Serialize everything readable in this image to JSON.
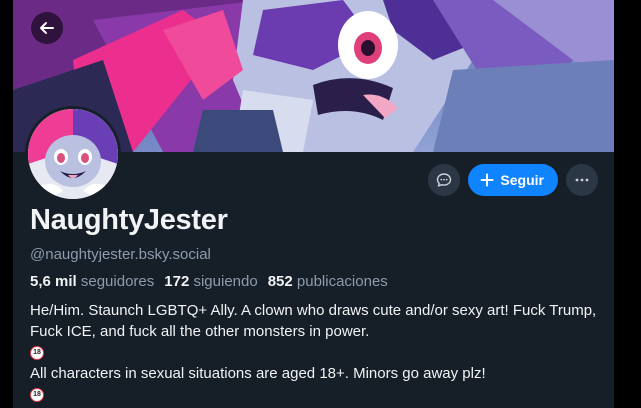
{
  "profile": {
    "display_name": "NaughtyJester",
    "handle": "@naughtyjester.bsky.social",
    "stats": {
      "followers_count": "5,6 mil",
      "followers_label": "seguidores",
      "following_count": "172",
      "following_label": "siguiendo",
      "posts_count": "852",
      "posts_label": "publicaciones"
    },
    "bio": {
      "line1": "He/Him. Staunch LGBTQ+ Ally. A clown who draws cute and/or sexy art! Fuck Trump, Fuck ICE, and fuck all the other monsters in power.",
      "badge1": "18",
      "line2": "All characters in sexual situations are aged 18+. Minors go away plz!",
      "badge2": "18"
    }
  },
  "actions": {
    "follow_label": "Seguir",
    "follow_icon": "plus-icon",
    "message_icon": "chat-bubble-icon",
    "more_icon": "ellipsis-icon"
  },
  "header": {
    "back_icon": "arrow-left-icon"
  },
  "colors": {
    "background": "#161e27",
    "accent": "#1083fe",
    "text_primary": "#f1f3f5",
    "text_secondary": "#8c9cad"
  }
}
